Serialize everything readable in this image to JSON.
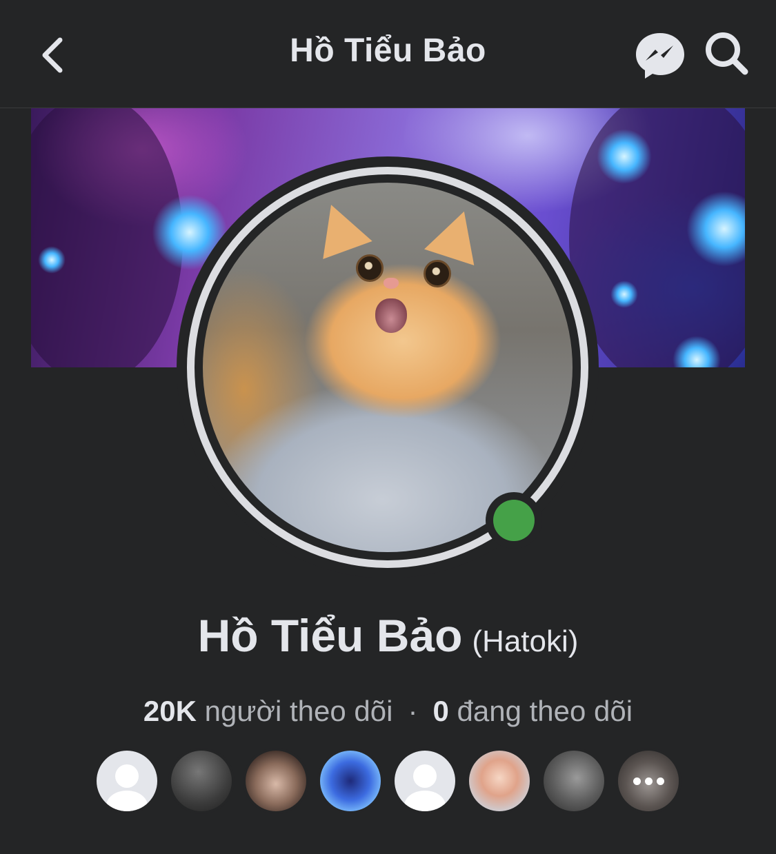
{
  "header": {
    "title": "Hồ Tiểu Bảo",
    "back_icon": "chevron-left-icon",
    "messenger_icon": "messenger-icon",
    "search_icon": "search-icon"
  },
  "profile": {
    "name": "Hồ Tiểu Bảo",
    "alt_name": "(Hatoki)",
    "online": true
  },
  "stats": {
    "followers_count": "20K",
    "followers_label": "người theo dõi",
    "separator": "·",
    "following_count": "0",
    "following_label": "đang theo dõi"
  },
  "follower_avatars": [
    {
      "kind": "default"
    },
    {
      "kind": "photo"
    },
    {
      "kind": "photo"
    },
    {
      "kind": "photo"
    },
    {
      "kind": "default"
    },
    {
      "kind": "photo"
    },
    {
      "kind": "photo"
    },
    {
      "kind": "photo-more"
    }
  ],
  "colors": {
    "background": "#242526",
    "text_primary": "#e4e6eb",
    "text_secondary": "#b0b3b8",
    "online": "#45a148"
  }
}
